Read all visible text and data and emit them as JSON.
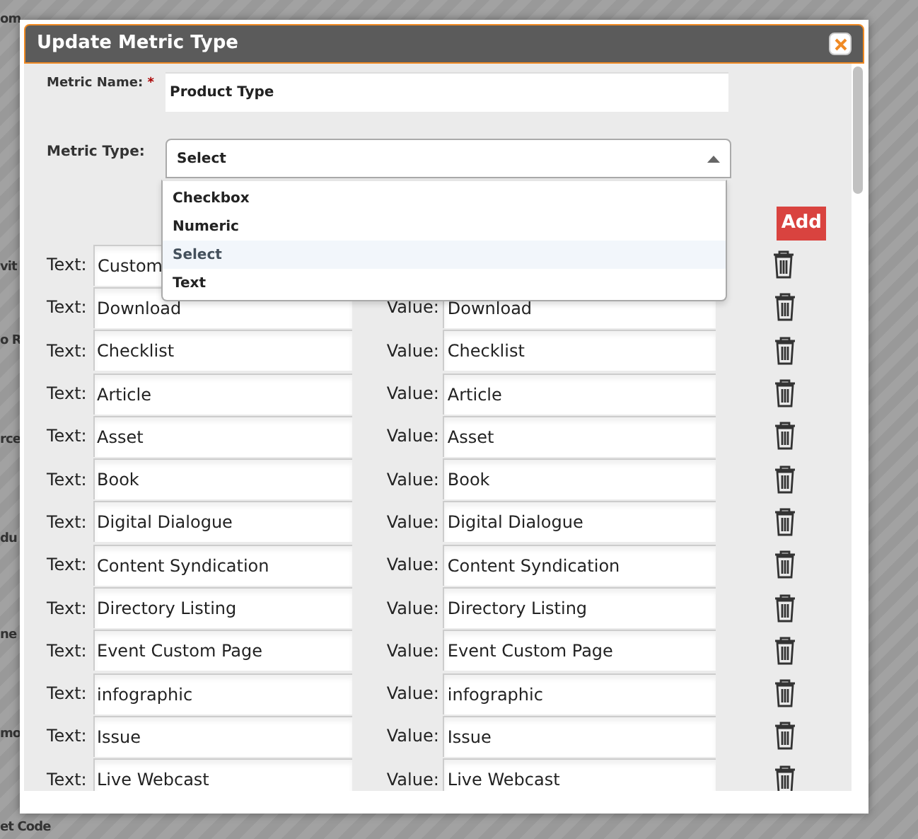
{
  "background_labels": [
    "om",
    "vit",
    "o R",
    "rce",
    "du",
    "ne",
    "mo",
    "et Code"
  ],
  "dialog": {
    "title": "Update Metric Type",
    "metric_name": {
      "label": "Metric Name:",
      "required_mark": "*",
      "value": "Product Type"
    },
    "metric_type": {
      "label": "Metric Type:",
      "value": "Select",
      "expanded": true,
      "options": [
        {
          "label": "Checkbox",
          "selected": false
        },
        {
          "label": "Numeric",
          "selected": false
        },
        {
          "label": "Select",
          "selected": true
        },
        {
          "label": "Text",
          "selected": false
        }
      ]
    },
    "add_button": "Add",
    "rows": [
      {
        "text_label": "Text:",
        "text": "Custom"
      },
      {
        "text_label": "Text:",
        "text": "Download",
        "value_label": "Value:",
        "value": "Download"
      },
      {
        "text_label": "Text:",
        "text": "Checklist",
        "value_label": "Value:",
        "value": "Checklist"
      },
      {
        "text_label": "Text:",
        "text": "Article",
        "value_label": "Value:",
        "value": "Article"
      },
      {
        "text_label": "Text:",
        "text": "Asset",
        "value_label": "Value:",
        "value": "Asset"
      },
      {
        "text_label": "Text:",
        "text": "Book",
        "value_label": "Value:",
        "value": "Book"
      },
      {
        "text_label": "Text:",
        "text": "Digital Dialogue",
        "value_label": "Value:",
        "value": "Digital Dialogue"
      },
      {
        "text_label": "Text:",
        "text": "Content Syndication",
        "value_label": "Value:",
        "value": "Content Syndication"
      },
      {
        "text_label": "Text:",
        "text": "Directory Listing",
        "value_label": "Value:",
        "value": "Directory Listing"
      },
      {
        "text_label": "Text:",
        "text": "Event Custom Page",
        "value_label": "Value:",
        "value": "Event Custom Page"
      },
      {
        "text_label": "Text:",
        "text": "infographic",
        "value_label": "Value:",
        "value": "infographic"
      },
      {
        "text_label": "Text:",
        "text": "Issue",
        "value_label": "Value:",
        "value": "Issue"
      },
      {
        "text_label": "Text:",
        "text": "Live Webcast",
        "value_label": "Value:",
        "value": "Live Webcast"
      }
    ]
  }
}
